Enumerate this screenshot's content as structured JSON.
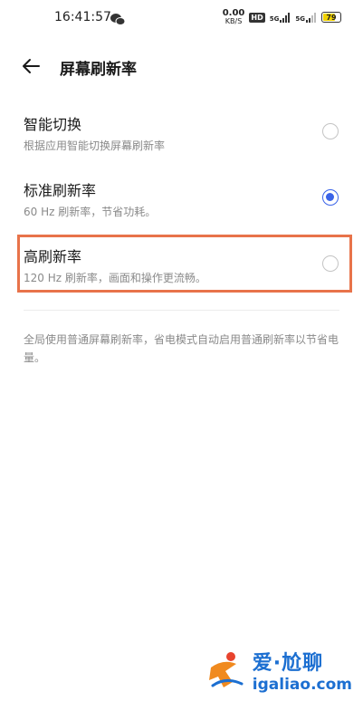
{
  "status_bar": {
    "time": "16:41:57",
    "net_speed_value": "0.00",
    "net_speed_unit": "KB/S",
    "hd_badge": "HD",
    "signal_label_1": "5G",
    "signal_label_2": "5G",
    "battery_level": "79",
    "battery_fraction": 0.79,
    "battery_color": "#f0d200"
  },
  "header": {
    "back_icon": "arrow-left-icon",
    "title": "屏幕刷新率"
  },
  "options": [
    {
      "title": "智能切换",
      "subtitle": "根据应用智能切换屏幕刷新率",
      "selected": false
    },
    {
      "title": "标准刷新率",
      "subtitle": "60 Hz 刷新率，节省功耗。",
      "selected": true
    },
    {
      "title": "高刷新率",
      "subtitle": "120 Hz 刷新率，画面和操作更流畅。",
      "selected": false
    }
  ],
  "footnote": "全局使用普通屏幕刷新率，省电模式自动启用普通刷新率以节省电量。",
  "colors": {
    "accent": "#3a63e8",
    "highlight": "#e8734a",
    "watermark": "#1c6fd1"
  },
  "watermark": {
    "name": "爱·尬聊",
    "url": "igaliao.com"
  }
}
